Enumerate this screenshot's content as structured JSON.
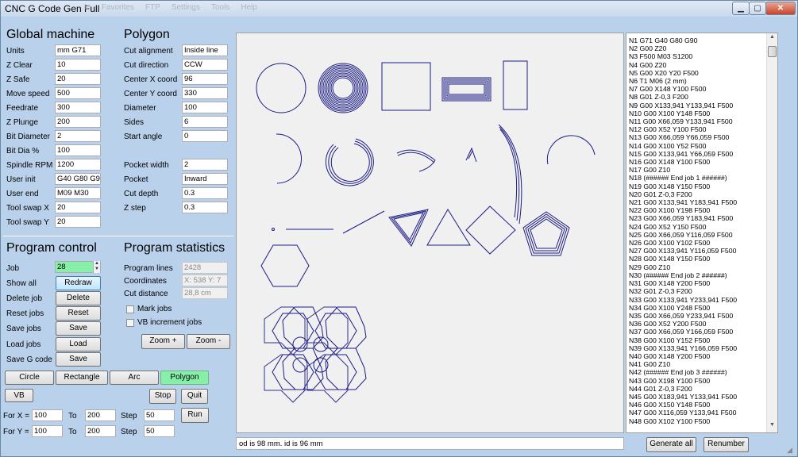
{
  "window": {
    "title": "CNC G Code Gen Full",
    "ghost_menu": [
      "le",
      "Favorites",
      "FTP",
      "Settings",
      "Tools",
      "Help"
    ],
    "min": "▁",
    "max": "▢",
    "close": "✕"
  },
  "global": {
    "heading": "Global machine",
    "fields": [
      {
        "label": "Units",
        "value": "mm G71"
      },
      {
        "label": "Z Clear",
        "value": "10"
      },
      {
        "label": "Z Safe",
        "value": "20"
      },
      {
        "label": "Move speed",
        "value": "500"
      },
      {
        "label": "Feedrate",
        "value": "300"
      },
      {
        "label": "Z Plunge",
        "value": "200"
      },
      {
        "label": "Bit Diameter",
        "value": "2"
      },
      {
        "label": "Bit Dia %",
        "value": "100"
      },
      {
        "label": "Spindle RPM",
        "value": "1200"
      },
      {
        "label": "User init",
        "value": "G40 G80 G90"
      },
      {
        "label": "User end",
        "value": "M09 M30"
      },
      {
        "label": "Tool swap X",
        "value": "20"
      },
      {
        "label": "Tool swap Y",
        "value": "20"
      }
    ]
  },
  "polygon": {
    "heading": "Polygon",
    "fields": [
      {
        "label": "Cut alignment",
        "value": "Inside line"
      },
      {
        "label": "Cut direction",
        "value": "CCW"
      },
      {
        "label": "Center X coord",
        "value": "96"
      },
      {
        "label": "Center Y coord",
        "value": "330"
      },
      {
        "label": "Diameter",
        "value": "100"
      },
      {
        "label": "Sides",
        "value": "6"
      },
      {
        "label": "Start angle",
        "value": "0"
      },
      {
        "label": "Pocket width",
        "value": "2"
      },
      {
        "label": "Pocket",
        "value": "Inward"
      },
      {
        "label": "Cut depth",
        "value": "0.3"
      },
      {
        "label": "Z step",
        "value": "0.3"
      }
    ]
  },
  "program_control": {
    "heading": "Program control",
    "job_label": "Job",
    "job_value": "28",
    "rows": [
      {
        "label": "Show all",
        "button": "Redraw"
      },
      {
        "label": "Delete job",
        "button": "Delete"
      },
      {
        "label": "Reset jobs",
        "button": "Reset"
      },
      {
        "label": "Save jobs",
        "button": "Save"
      },
      {
        "label": "Load jobs",
        "button": "Load"
      },
      {
        "label": "Save G code",
        "button": "Save"
      }
    ]
  },
  "program_statistics": {
    "heading": "Program statistics",
    "lines_label": "Program lines",
    "lines_value": "2428",
    "coords_label": "Coordinates",
    "coords_value": "X: 538  Y: 7",
    "dist_label": "Cut distance",
    "dist_value": "28,8 cm",
    "mark_jobs": "Mark jobs",
    "vb_increment": "VB increment jobs",
    "zoom_in": "Zoom +",
    "zoom_out": "Zoom -"
  },
  "shape_tabs": [
    "Circle",
    "Rectangle",
    "Arc",
    "Polygon"
  ],
  "vb": {
    "button": "VB",
    "stop": "Stop",
    "quit": "Quit",
    "run": "Run",
    "for_x": {
      "label": "For X =",
      "from": "100",
      "to_label": "To",
      "to": "200",
      "step_label": "Step",
      "step": "50"
    },
    "for_y": {
      "label": "For Y =",
      "from": "100",
      "to_label": "To",
      "to": "200",
      "step_label": "Step",
      "step": "50"
    }
  },
  "status": "od is 98 mm. id is 96 mm",
  "buttons": {
    "generate_all": "Generate all",
    "renumber": "Renumber"
  },
  "gcode": [
    "N1 G71 G40 G80 G90",
    "N2 G00 Z20",
    "N3  F500 M03 S1200",
    "N4 G00 Z20",
    "N5 G00 X20 Y20 F500",
    "N6 T1 M06 (2 mm)",
    "N7 G00 X148 Y100 F500",
    "N8 G01 Z-0,3 F200",
    "N9 G00 X133,941 Y133,941 F500",
    "N10 G00 X100 Y148 F500",
    "N11 G00 X66,059 Y133,941 F500",
    "N12 G00 X52 Y100 F500",
    "N13 G00 X66,059 Y66,059 F500",
    "N14 G00 X100 Y52 F500",
    "N15 G00 X133,941 Y66,059 F500",
    "N16 G00 X148 Y100 F500",
    "N17 G00 Z10",
    "N18 (###### End job 1  ######)",
    "N19 G00 X148 Y150 F500",
    "N20 G01 Z-0,3 F200",
    "N21 G00 X133,941 Y183,941 F500",
    "N22 G00 X100 Y198 F500",
    "N23 G00 X66,059 Y183,941 F500",
    "N24 G00 X52 Y150 F500",
    "N25 G00 X66,059 Y116,059 F500",
    "N26 G00 X100 Y102 F500",
    "N27 G00 X133,941 Y116,059 F500",
    "N28 G00 X148 Y150 F500",
    "N29 G00 Z10",
    "N30 (###### End job 2  ######)",
    "N31 G00 X148 Y200 F500",
    "N32 G01 Z-0,3 F200",
    "N33 G00 X133,941 Y233,941 F500",
    "N34 G00 X100 Y248 F500",
    "N35 G00 X66,059 Y233,941 F500",
    "N36 G00 X52 Y200 F500",
    "N37 G00 X66,059 Y166,059 F500",
    "N38 G00 X100 Y152 F500",
    "N39 G00 X133,941 Y166,059 F500",
    "N40 G00 X148 Y200 F500",
    "N41 G00 Z10",
    "N42 (###### End job 3  ######)",
    "N43 G00 X198 Y100 F500",
    "N44 G01 Z-0,3 F200",
    "N45 G00 X183,941 Y133,941 F500",
    "N46 G00 X150 Y148 F500",
    "N47 G00 X116,059 Y133,941 F500",
    "N48 G00 X102 Y100 F500"
  ],
  "colors": {
    "stroke": "#1c1c86",
    "highlight": "#86efa8"
  }
}
